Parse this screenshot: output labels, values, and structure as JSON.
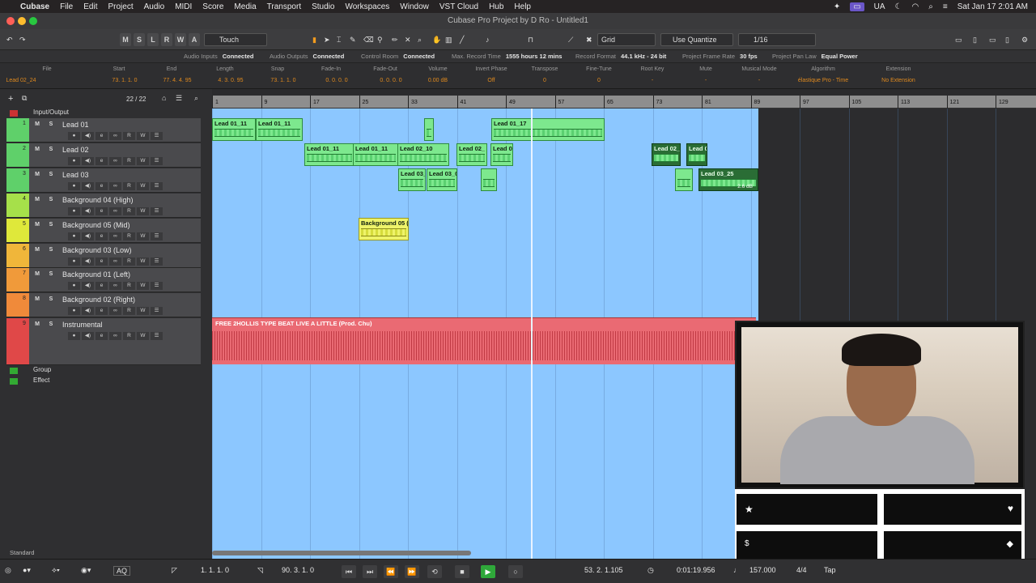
{
  "menubar": {
    "app": "Cubase",
    "items": [
      "File",
      "Edit",
      "Project",
      "Audio",
      "MIDI",
      "Score",
      "Media",
      "Transport",
      "Studio",
      "Workspaces",
      "Window",
      "VST Cloud",
      "Hub",
      "Help"
    ],
    "right": {
      "input_lang": "UA",
      "datetime": "Sat Jan 17  2:01 AM"
    }
  },
  "window": {
    "title": "Cubase Pro Project by D Ro - Untitled1"
  },
  "toolbar": {
    "buttons": [
      "M",
      "S",
      "L",
      "R",
      "W",
      "A"
    ],
    "automation_mode": "Touch",
    "snap_type": "Grid",
    "quantize_mode": "Use Quantize",
    "quantize_value": "1/16"
  },
  "status": [
    {
      "label": "Audio Inputs",
      "value": "Connected"
    },
    {
      "label": "Audio Outputs",
      "value": "Connected"
    },
    {
      "label": "Control Room",
      "value": "Connected"
    },
    {
      "label": "Max. Record Time",
      "value": "1555 hours 12 mins"
    },
    {
      "label": "Record Format",
      "value": "44.1 kHz - 24 bit"
    },
    {
      "label": "Project Frame Rate",
      "value": "30 fps"
    },
    {
      "label": "Project Pan Law",
      "value": "Equal Power"
    }
  ],
  "infoline": {
    "headers": [
      "File",
      "Start",
      "End",
      "Length",
      "Snap",
      "Fade-In",
      "Fade-Out",
      "Volume",
      "Invert Phase",
      "Transpose",
      "Fine-Tune",
      "Root Key",
      "Mute",
      "Musical Mode",
      "Algorithm",
      "Extension"
    ],
    "values": [
      "Lead 02_24",
      "73. 1. 1.   0",
      "77. 4. 4. 95",
      "4. 3. 0. 95",
      "73. 1. 1.   0",
      "0. 0. 0.   0",
      "0. 0. 0.   0",
      "0.00    dB",
      "Off",
      "0",
      "0",
      "-",
      "-",
      "-",
      "élastique Pro - Time",
      "No Extension"
    ]
  },
  "trackhead": {
    "counter": "22 / 22",
    "io_folder": "Input/Output",
    "group_folder": "Group",
    "effect_folder": "Effect",
    "footer": "Standard"
  },
  "tracks": [
    {
      "num": "1",
      "name": "Lead 01",
      "color": "#5fd06a"
    },
    {
      "num": "2",
      "name": "Lead 02",
      "color": "#5fd06a"
    },
    {
      "num": "3",
      "name": "Lead 03",
      "color": "#5fd06a"
    },
    {
      "num": "4",
      "name": "Background 04 (High)",
      "color": "#a6e04a"
    },
    {
      "num": "5",
      "name": "Background 05 (Mid)",
      "color": "#dfe83a"
    },
    {
      "num": "6",
      "name": "Background 03 (Low)",
      "color": "#f0b63a"
    },
    {
      "num": "7",
      "name": "Background 01 (Left)",
      "color": "#f09a3a"
    },
    {
      "num": "8",
      "name": "Background 02 (Right)",
      "color": "#f08a3a"
    },
    {
      "num": "9",
      "name": "Instrumental",
      "color": "#e04848"
    }
  ],
  "track_btn_labels": {
    "mute": "M",
    "solo": "S",
    "read": "R",
    "write": "W"
  },
  "ruler": {
    "bars": [
      "1",
      "9",
      "17",
      "25",
      "33",
      "41",
      "49",
      "57",
      "65",
      "73",
      "81",
      "89",
      "97",
      "105",
      "113",
      "121",
      "129"
    ]
  },
  "clips": [
    {
      "name": "Lead 01_11"
    },
    {
      "name": "Lead 01_11"
    },
    {
      "name": ""
    },
    {
      "name": "Lead 01_17"
    },
    {
      "name": "Lead 01_11"
    },
    {
      "name": "Lead 01_11"
    },
    {
      "name": "Lead 02_10"
    },
    {
      "name": "Lead 02_"
    },
    {
      "name": "Lead 0"
    },
    {
      "name": "Lead 02_"
    },
    {
      "name": "Lead 0"
    },
    {
      "name": "Lead 03_"
    },
    {
      "name": "Lead 03_0"
    },
    {
      "name": ""
    },
    {
      "name": ""
    },
    {
      "name": "Lead 03_25"
    },
    {
      "name": "Background 05 ("
    }
  ],
  "clip_gain": "2.6 dB",
  "instrumental_clip": "FREE 2HOLLIS TYPE BEAT  LIVE A LITTLE (Prod. Chu)",
  "transport": {
    "left_locator": "1. 1. 1.    0",
    "right_locator": "90. 3. 1.    0",
    "position_bars": "53. 2. 1.105",
    "position_time": "0:01:19.956",
    "tempo": "157.000",
    "signature": "4/4",
    "tap": "Tap",
    "aq": "AQ"
  }
}
